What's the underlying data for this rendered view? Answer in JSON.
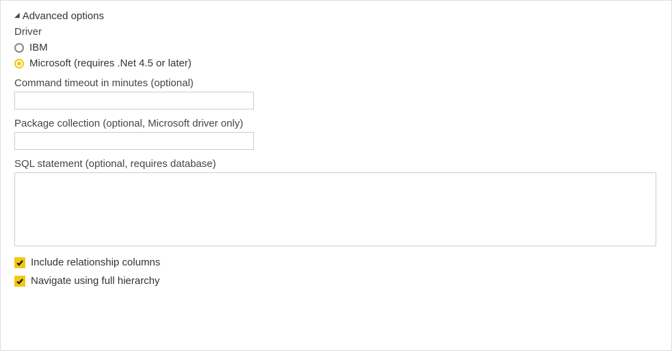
{
  "section": {
    "title": "Advanced options"
  },
  "driver": {
    "label": "Driver",
    "options": {
      "ibm": {
        "label": "IBM",
        "selected": false
      },
      "microsoft": {
        "label": "Microsoft (requires .Net 4.5 or later)",
        "selected": true
      }
    }
  },
  "command_timeout": {
    "label": "Command timeout in minutes (optional)",
    "value": ""
  },
  "package_collection": {
    "label": "Package collection (optional, Microsoft driver only)",
    "value": ""
  },
  "sql_statement": {
    "label": "SQL statement (optional, requires database)",
    "value": ""
  },
  "checkboxes": {
    "include_relationship": {
      "label": "Include relationship columns",
      "checked": true
    },
    "navigate_hierarchy": {
      "label": "Navigate using full hierarchy",
      "checked": true
    }
  }
}
